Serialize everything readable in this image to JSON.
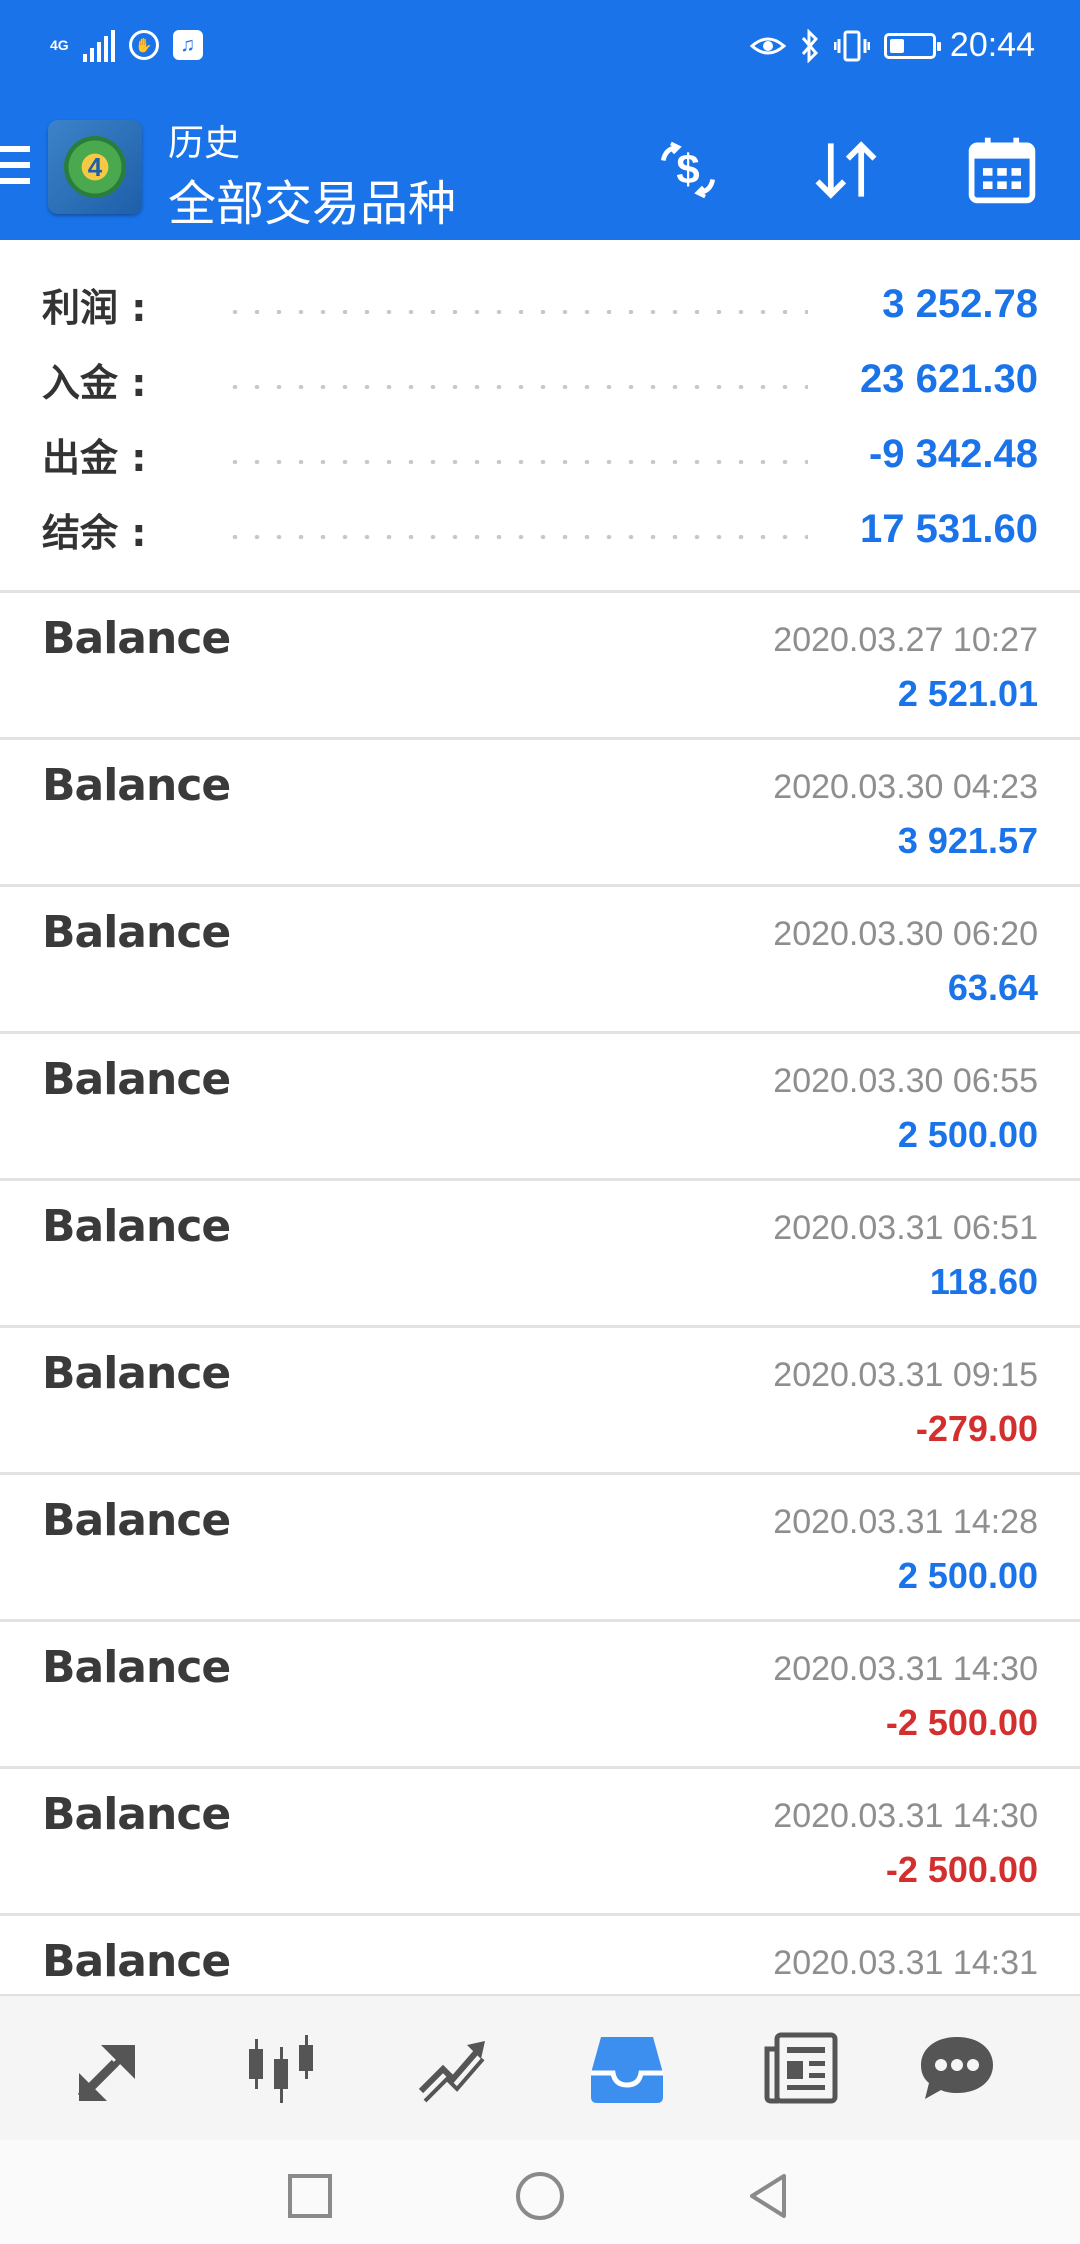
{
  "status_bar": {
    "network_label": "4G",
    "time": "20:44"
  },
  "toolbar": {
    "title": "历史",
    "subtitle": "全部交易品种",
    "icons": [
      "menu-icon",
      "metatrader-logo",
      "currency-exchange-icon",
      "sort-icon",
      "calendar-icon"
    ]
  },
  "summary": {
    "profit": {
      "label": "利润 :",
      "value": "3 252.78"
    },
    "deposit": {
      "label": "入金 :",
      "value": "23 621.30"
    },
    "withdrawal": {
      "label": "出金 :",
      "value": "-9 342.48"
    },
    "balance": {
      "label": "结余 :",
      "value": "17 531.60"
    }
  },
  "history": [
    {
      "name": "Balance",
      "date": "2020.03.27 10:27",
      "amount": "2 521.01",
      "negative": false
    },
    {
      "name": "Balance",
      "date": "2020.03.30 04:23",
      "amount": "3 921.57",
      "negative": false
    },
    {
      "name": "Balance",
      "date": "2020.03.30 06:20",
      "amount": "63.64",
      "negative": false
    },
    {
      "name": "Balance",
      "date": "2020.03.30 06:55",
      "amount": "2 500.00",
      "negative": false
    },
    {
      "name": "Balance",
      "date": "2020.03.31 06:51",
      "amount": "118.60",
      "negative": false
    },
    {
      "name": "Balance",
      "date": "2020.03.31 09:15",
      "amount": "-279.00",
      "negative": true
    },
    {
      "name": "Balance",
      "date": "2020.03.31 14:28",
      "amount": "2 500.00",
      "negative": false
    },
    {
      "name": "Balance",
      "date": "2020.03.31 14:30",
      "amount": "-2 500.00",
      "negative": true
    },
    {
      "name": "Balance",
      "date": "2020.03.31 14:30",
      "amount": "-2 500.00",
      "negative": true
    },
    {
      "name": "Balance",
      "date": "2020.03.31 14:31",
      "amount": "",
      "negative": false
    }
  ],
  "bottom_nav": {
    "items": [
      "quotes-icon",
      "chart-icon",
      "trade-icon",
      "history-icon",
      "news-icon",
      "chat-icon"
    ],
    "active": "history-icon"
  },
  "colors": {
    "brand": "#1a73e8",
    "positive": "#1a73e8",
    "negative": "#d32f2f",
    "text": "#3a3a3a",
    "muted": "#8e8e8e"
  }
}
